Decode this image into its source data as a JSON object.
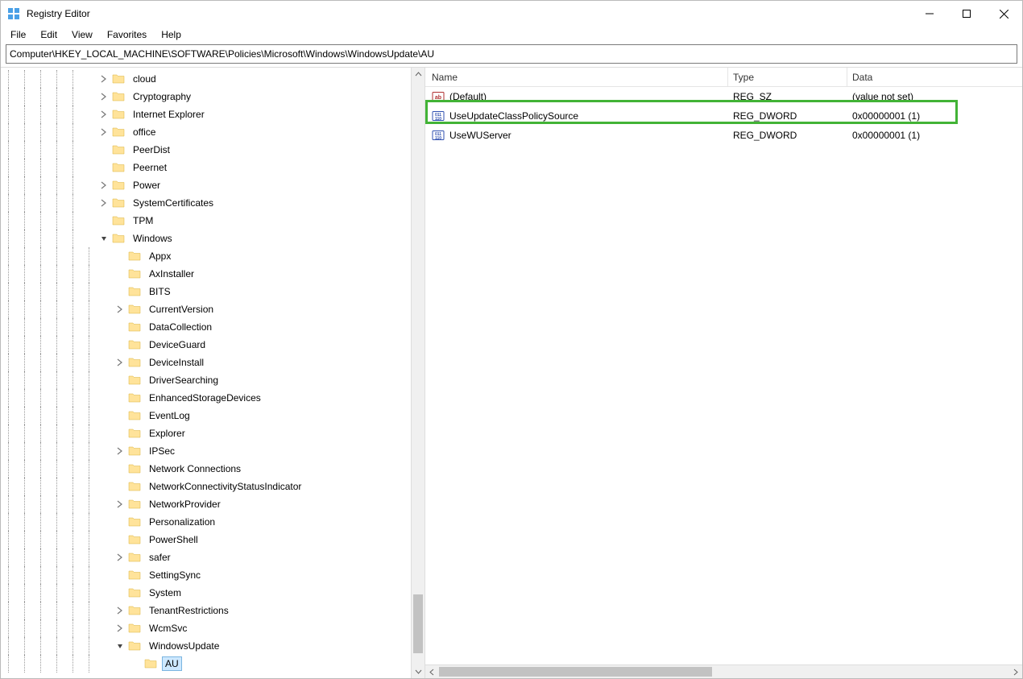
{
  "window": {
    "title": "Registry Editor"
  },
  "menu": {
    "items": [
      "File",
      "Edit",
      "View",
      "Favorites",
      "Help"
    ]
  },
  "address": {
    "path": "Computer\\HKEY_LOCAL_MACHINE\\SOFTWARE\\Policies\\Microsoft\\Windows\\WindowsUpdate\\AU"
  },
  "tree": {
    "items": [
      {
        "depth": 6,
        "label": "cloud",
        "expander": "closed",
        "lines": [
          1,
          1,
          1,
          1,
          1,
          0
        ]
      },
      {
        "depth": 6,
        "label": "Cryptography",
        "expander": "closed",
        "lines": [
          1,
          1,
          1,
          1,
          1,
          0
        ]
      },
      {
        "depth": 6,
        "label": "Internet Explorer",
        "expander": "closed",
        "lines": [
          1,
          1,
          1,
          1,
          1,
          0
        ]
      },
      {
        "depth": 6,
        "label": "office",
        "expander": "closed",
        "lines": [
          1,
          1,
          1,
          1,
          1,
          0
        ]
      },
      {
        "depth": 6,
        "label": "PeerDist",
        "expander": "none",
        "lines": [
          1,
          1,
          1,
          1,
          1,
          0
        ]
      },
      {
        "depth": 6,
        "label": "Peernet",
        "expander": "none",
        "lines": [
          1,
          1,
          1,
          1,
          1,
          0
        ]
      },
      {
        "depth": 6,
        "label": "Power",
        "expander": "closed",
        "lines": [
          1,
          1,
          1,
          1,
          1,
          0
        ]
      },
      {
        "depth": 6,
        "label": "SystemCertificates",
        "expander": "closed",
        "lines": [
          1,
          1,
          1,
          1,
          1,
          0
        ]
      },
      {
        "depth": 6,
        "label": "TPM",
        "expander": "none",
        "lines": [
          1,
          1,
          1,
          1,
          1,
          0
        ]
      },
      {
        "depth": 6,
        "label": "Windows",
        "expander": "open",
        "lines": [
          1,
          1,
          1,
          1,
          1,
          0
        ]
      },
      {
        "depth": 7,
        "label": "Appx",
        "expander": "none",
        "lines": [
          1,
          1,
          1,
          1,
          1,
          1,
          0
        ]
      },
      {
        "depth": 7,
        "label": "AxInstaller",
        "expander": "none",
        "lines": [
          1,
          1,
          1,
          1,
          1,
          1,
          0
        ]
      },
      {
        "depth": 7,
        "label": "BITS",
        "expander": "none",
        "lines": [
          1,
          1,
          1,
          1,
          1,
          1,
          0
        ]
      },
      {
        "depth": 7,
        "label": "CurrentVersion",
        "expander": "closed",
        "lines": [
          1,
          1,
          1,
          1,
          1,
          1,
          0
        ]
      },
      {
        "depth": 7,
        "label": "DataCollection",
        "expander": "none",
        "lines": [
          1,
          1,
          1,
          1,
          1,
          1,
          0
        ]
      },
      {
        "depth": 7,
        "label": "DeviceGuard",
        "expander": "none",
        "lines": [
          1,
          1,
          1,
          1,
          1,
          1,
          0
        ]
      },
      {
        "depth": 7,
        "label": "DeviceInstall",
        "expander": "closed",
        "lines": [
          1,
          1,
          1,
          1,
          1,
          1,
          0
        ]
      },
      {
        "depth": 7,
        "label": "DriverSearching",
        "expander": "none",
        "lines": [
          1,
          1,
          1,
          1,
          1,
          1,
          0
        ]
      },
      {
        "depth": 7,
        "label": "EnhancedStorageDevices",
        "expander": "none",
        "lines": [
          1,
          1,
          1,
          1,
          1,
          1,
          0
        ]
      },
      {
        "depth": 7,
        "label": "EventLog",
        "expander": "none",
        "lines": [
          1,
          1,
          1,
          1,
          1,
          1,
          0
        ]
      },
      {
        "depth": 7,
        "label": "Explorer",
        "expander": "none",
        "lines": [
          1,
          1,
          1,
          1,
          1,
          1,
          0
        ]
      },
      {
        "depth": 7,
        "label": "IPSec",
        "expander": "closed",
        "lines": [
          1,
          1,
          1,
          1,
          1,
          1,
          0
        ]
      },
      {
        "depth": 7,
        "label": "Network Connections",
        "expander": "none",
        "lines": [
          1,
          1,
          1,
          1,
          1,
          1,
          0
        ]
      },
      {
        "depth": 7,
        "label": "NetworkConnectivityStatusIndicator",
        "expander": "none",
        "lines": [
          1,
          1,
          1,
          1,
          1,
          1,
          0
        ]
      },
      {
        "depth": 7,
        "label": "NetworkProvider",
        "expander": "closed",
        "lines": [
          1,
          1,
          1,
          1,
          1,
          1,
          0
        ]
      },
      {
        "depth": 7,
        "label": "Personalization",
        "expander": "none",
        "lines": [
          1,
          1,
          1,
          1,
          1,
          1,
          0
        ]
      },
      {
        "depth": 7,
        "label": "PowerShell",
        "expander": "none",
        "lines": [
          1,
          1,
          1,
          1,
          1,
          1,
          0
        ]
      },
      {
        "depth": 7,
        "label": "safer",
        "expander": "closed",
        "lines": [
          1,
          1,
          1,
          1,
          1,
          1,
          0
        ]
      },
      {
        "depth": 7,
        "label": "SettingSync",
        "expander": "none",
        "lines": [
          1,
          1,
          1,
          1,
          1,
          1,
          0
        ]
      },
      {
        "depth": 7,
        "label": "System",
        "expander": "none",
        "lines": [
          1,
          1,
          1,
          1,
          1,
          1,
          0
        ]
      },
      {
        "depth": 7,
        "label": "TenantRestrictions",
        "expander": "closed",
        "lines": [
          1,
          1,
          1,
          1,
          1,
          1,
          0
        ]
      },
      {
        "depth": 7,
        "label": "WcmSvc",
        "expander": "closed",
        "lines": [
          1,
          1,
          1,
          1,
          1,
          1,
          0
        ]
      },
      {
        "depth": 7,
        "label": "WindowsUpdate",
        "expander": "open",
        "lines": [
          1,
          1,
          1,
          1,
          1,
          1,
          0
        ]
      },
      {
        "depth": 8,
        "label": "AU",
        "selected": true,
        "expander": "none",
        "lines": [
          1,
          1,
          1,
          1,
          1,
          1,
          0,
          0
        ]
      }
    ]
  },
  "list": {
    "headers": {
      "name": "Name",
      "type": "Type",
      "data": "Data"
    },
    "rows": [
      {
        "name": "(Default)",
        "type": "REG_SZ",
        "data": "(value not set)",
        "icon": "string"
      },
      {
        "name": "UseUpdateClassPolicySource",
        "type": "REG_DWORD",
        "data": "0x00000001 (1)",
        "icon": "dword",
        "highlighted": true
      },
      {
        "name": "UseWUServer",
        "type": "REG_DWORD",
        "data": "0x00000001 (1)",
        "icon": "dword"
      }
    ]
  }
}
